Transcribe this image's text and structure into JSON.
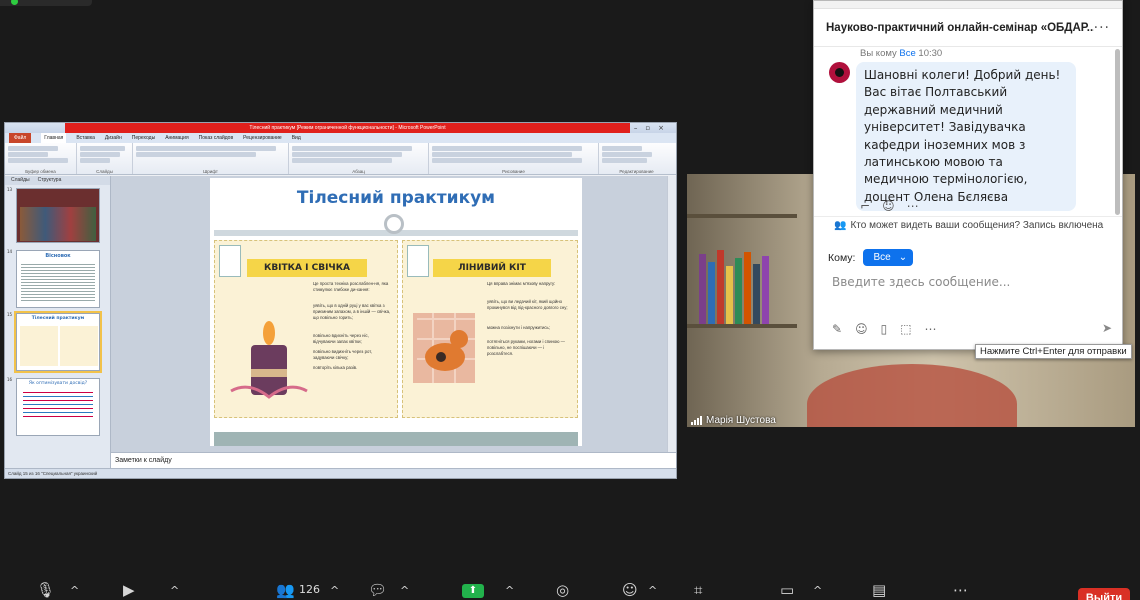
{
  "ppt": {
    "title": "Тілесний практикум [Режим ограниченной функциональности] - Microsoft PowerPoint",
    "tabs": [
      "Файл",
      "Главная",
      "Вставка",
      "Дизайн",
      "Переходы",
      "Анимация",
      "Показ слайдов",
      "Рецензирование",
      "Вид"
    ],
    "thumb_tabs": [
      "Слайды",
      "Структура"
    ],
    "thumb_numbers": [
      "13",
      "14",
      "15",
      "16"
    ],
    "thumb_titles": [
      "Вісновок",
      "Тілесний практикум",
      "Як оптимізувати досвід?"
    ],
    "ribbon_groups": [
      "Буфер обмена",
      "Слайды",
      "Шрифт",
      "Абзац",
      "Рисование",
      "Редактирование"
    ],
    "slide": {
      "title": "Тілесний практикум",
      "card_left_title": "КВІТКА І СВІЧКА",
      "card_right_title": "ЛІНИВИЙ КІТ",
      "left_intro": "Це проста техніка розслаблен-ня, яка стимулює глибоке ди-хання:",
      "left_items": [
        "уявіть, що в одній руці у вас квітка з приємним запахом, а в іншій — свічка, що повільно горить;",
        "повільно вдихніть через ніс, відчуваючи запах квітки;",
        "повільно видихніть через рот, задуваючи свічку;",
        "повторіть кілька разів."
      ],
      "right_intro": "Ця вправа знімає м'язову напругу:",
      "right_items": [
        "уявіть, що ви ледачий кіт, який щойно прокинувся від під-красного довгого сну;",
        "можна позіхнути і напружитись;",
        "потягніться руками, ногами і спиною — повільно, не поспішаючи — і розслабтеся."
      ]
    },
    "notes": "Заметки к слайду",
    "status": "Слайд 15 из 16   \"Специальная\"   украинский"
  },
  "video": {
    "name": "Марія Шустова"
  },
  "chat": {
    "title": "Науково-практичний онлайн-семінар «ОБДАР...",
    "meta_prefix": "Вы кому",
    "meta_to": "Все",
    "meta_time": "10:30",
    "message": "Шановні колеги! Добрий день! Вас вітає Полтавський державний медичний університет! Завідувачка кафедри іноземних мов з латинською мовою та медичною термінологією, доцент Олена Бєляєва",
    "visibility": "Кто может видеть ваши сообщения? Запись включена",
    "to_label": "Кому:",
    "to_value": "Все",
    "placeholder": "Введите здесь сообщение...",
    "tooltip": "Нажмите Ctrl+Enter для отправки"
  },
  "controls": {
    "participants_count": "126",
    "leave": "Выйти"
  },
  "colors": {
    "accent": "#0e72ed",
    "leave": "#d93025",
    "share": "#22b24c",
    "slide_title": "#2f6db5",
    "card_head": "#f5d548"
  }
}
